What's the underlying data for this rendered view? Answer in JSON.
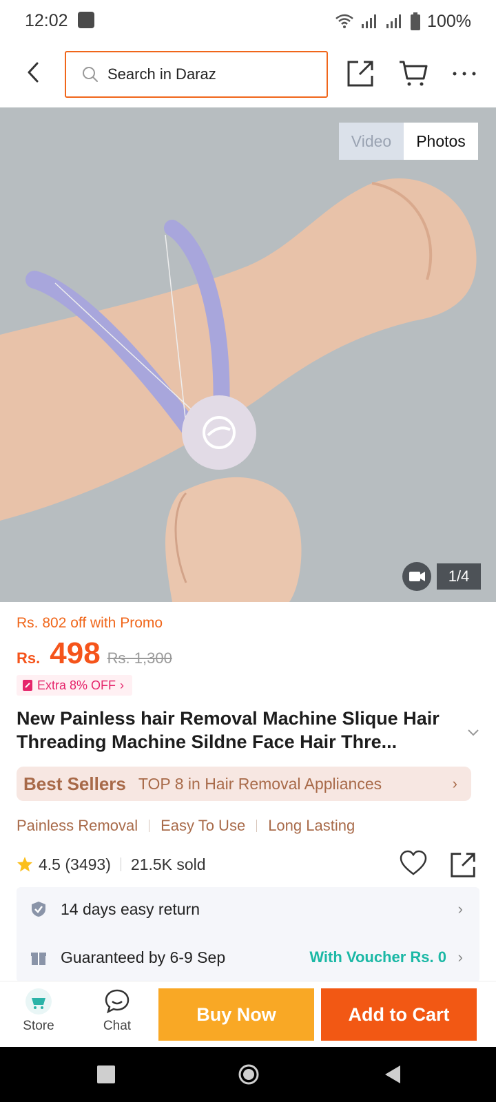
{
  "status_bar": {
    "time": "12:02",
    "battery": "100%"
  },
  "header": {
    "search_placeholder": "Search in Daraz"
  },
  "media": {
    "video_tab": "Video",
    "photos_tab": "Photos",
    "counter": "1/4"
  },
  "price": {
    "promo_text": "Rs. 802 off with Promo",
    "currency": "Rs.",
    "current": "498",
    "original": "Rs. 1,300",
    "extra_off": "Extra 8% OFF"
  },
  "product": {
    "title": "New Painless hair Removal Machine Slique Hair Threading Machine Sildne Face Hair Thre..."
  },
  "best_sellers": {
    "label": "Best Sellers",
    "rank_text": "TOP 8 in Hair Removal Appliances"
  },
  "features": [
    "Painless Removal",
    "Easy To Use",
    "Long Lasting"
  ],
  "rating": {
    "score_text": "4.5 (3493)",
    "sold": "21.5K sold"
  },
  "service": {
    "return_text": "14 days easy return",
    "delivery_text": "Guaranteed by 6-9 Sep",
    "voucher_text": "With Voucher Rs. 0"
  },
  "actions": {
    "store_label": "Store",
    "chat_label": "Chat",
    "buy_now": "Buy Now",
    "add_to_cart": "Add to Cart"
  },
  "colors": {
    "accent_orange": "#f25814",
    "buy_yellow": "#f9a825",
    "best_seller_brown": "#a86a49",
    "voucher_teal": "#1bb8a5"
  },
  "icons": [
    "wifi-icon",
    "signal-icon",
    "battery-icon",
    "back-arrow-icon",
    "search-icon",
    "share-icon",
    "cart-icon",
    "more-icon",
    "video-camera-icon",
    "star-icon",
    "heart-icon",
    "shield-check-icon",
    "gift-icon",
    "chevron-right-icon",
    "chat-icon",
    "store-logo",
    "nav-recent-icon",
    "nav-home-icon",
    "nav-back-icon"
  ]
}
